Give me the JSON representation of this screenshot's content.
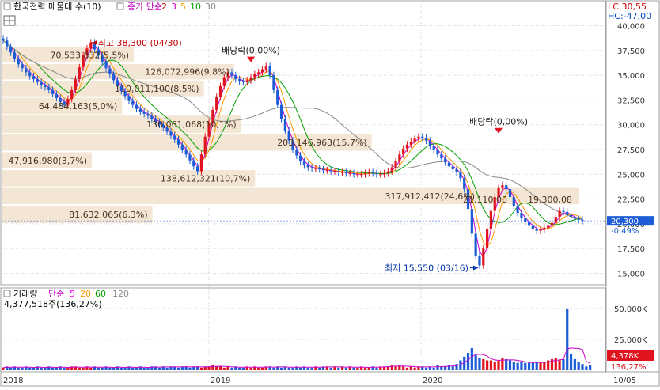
{
  "header": {
    "title": "한국전력 매물대 수(10)",
    "ma_label": "종가 단순",
    "ma_periods": [
      "2",
      "3",
      "5",
      "10",
      "30"
    ],
    "ma_colors": [
      "#c00000",
      "#ff00ff",
      "#ff9900",
      "#00a000",
      "#888888"
    ],
    "lc_text": "LC:30,55",
    "hc_text": "HC:-47,00"
  },
  "volume_header": {
    "label": "거래량",
    "ma_label": "단순",
    "ma_periods": [
      "5",
      "20",
      "60",
      "120"
    ],
    "ma_colors": [
      "#ff00ff",
      "#ff9900",
      "#00a000",
      "#888888"
    ],
    "value_text": "4,377,518주(136,27%)"
  },
  "chart_data": [
    {
      "type": "candlestick",
      "title": "한국전력 매물대 수(10)",
      "x_labels": [
        "2018",
        "2019",
        "2020",
        "10/05"
      ],
      "ylim": [
        14000,
        41000
      ],
      "y_ticks": [
        15000,
        17500,
        20000,
        22500,
        25000,
        27500,
        30000,
        32500,
        35000,
        37500,
        40000
      ],
      "y_tick_labels": [
        "15,000",
        "17,500",
        "20,000",
        "22,500",
        "25,000",
        "27,500",
        "30,000",
        "32,500",
        "35,000",
        "37,500",
        "40,000"
      ],
      "current_price": 20300,
      "current_price_text": "20,300",
      "current_change_text": "-0,49%",
      "close_series": [
        38500,
        37900,
        37300,
        36700,
        36100,
        35700,
        35300,
        34900,
        34600,
        34300,
        34000,
        33800,
        33500,
        33100,
        32700,
        32300,
        32000,
        32600,
        33500,
        34600,
        35800,
        37000,
        37700,
        38300,
        37600,
        37000,
        36300,
        35700,
        35100,
        34500,
        33900,
        33400,
        32900,
        32400,
        32000,
        31600,
        31300,
        31100,
        30900,
        30600,
        30300,
        30000,
        29700,
        29300,
        28900,
        28500,
        28000,
        27500,
        27000,
        26400,
        25800,
        25300,
        27000,
        28800,
        30200,
        31500,
        32800,
        33900,
        34800,
        35300,
        35000,
        34600,
        34400,
        34300,
        34500,
        34800,
        35100,
        35300,
        35600,
        35900,
        35000,
        33500,
        32000,
        30600,
        29400,
        28400,
        27500,
        26900,
        26300,
        25900,
        25700,
        25600,
        25600,
        25500,
        25400,
        25400,
        25300,
        25300,
        25200,
        25200,
        25100,
        25100,
        25000,
        25000,
        25000,
        25100,
        25200,
        25100,
        25000,
        25000,
        25100,
        25300,
        25700,
        26300,
        27000,
        27600,
        28000,
        28300,
        28600,
        28800,
        28700,
        28400,
        27900,
        27500,
        27000,
        26600,
        26200,
        25800,
        25500,
        25200,
        24600,
        23500,
        21500,
        19000,
        16800,
        15800,
        17500,
        19500,
        21300,
        22700,
        23600,
        23900,
        23500,
        22700,
        21800,
        21100,
        20600,
        20200,
        19800,
        19500,
        19300,
        19400,
        19600,
        19800,
        20100,
        20700,
        21300,
        21200,
        20900,
        20700,
        20500,
        20400,
        20300
      ],
      "volume_series": [
        2,
        3,
        2,
        3,
        2,
        2,
        3,
        2,
        2,
        3,
        2,
        2,
        3,
        2,
        2,
        3,
        2,
        2,
        3,
        3,
        2,
        2,
        3,
        2,
        3,
        2,
        2,
        3,
        2,
        2,
        3,
        2,
        2,
        3,
        2,
        2,
        3,
        2,
        2,
        3,
        3,
        2,
        3,
        2,
        3,
        3,
        2,
        3,
        3,
        2,
        3,
        3,
        2,
        3,
        3,
        4,
        3,
        3,
        2,
        3,
        2,
        3,
        2,
        2,
        3,
        2,
        3,
        2,
        2,
        3,
        3,
        2,
        3,
        2,
        3,
        2,
        2,
        3,
        2,
        3,
        2,
        2,
        3,
        2,
        3,
        3,
        2,
        3,
        2,
        3,
        2,
        3,
        2,
        2,
        3,
        2,
        2,
        3,
        2,
        3,
        3,
        3,
        4,
        3,
        4,
        3,
        2,
        3,
        2,
        3,
        3,
        2,
        3,
        2,
        4,
        3,
        3,
        4,
        3,
        5,
        8,
        11,
        14,
        18,
        12,
        10,
        9,
        8,
        8,
        7,
        8,
        10,
        9,
        8,
        7,
        6,
        7,
        6,
        6,
        6,
        7,
        6,
        7,
        8,
        9,
        10,
        8,
        9,
        50,
        13,
        9,
        7,
        5,
        3,
        4
      ],
      "volume_ylim": [
        0,
        64000000
      ],
      "volume_ticks": [
        25000000,
        50000000
      ],
      "volume_tick_labels": [
        "25,000K",
        "50,000K"
      ],
      "volume_current_text": "4,378K",
      "volume_current_pct": "136,27%",
      "volume_profile": [
        {
          "price_from": 36200,
          "price_to": 37900,
          "label": "70,533,832(5,5%)",
          "share": 5.5
        },
        {
          "price_from": 34500,
          "price_to": 36200,
          "label": "126,072,996(9,8%)",
          "share": 9.8
        },
        {
          "price_from": 32800,
          "price_to": 34500,
          "label": "110,011,100(8,5%)",
          "share": 8.5
        },
        {
          "price_from": 31000,
          "price_to": 32800,
          "label": "64,484,163(5,0%)",
          "share": 5.0
        },
        {
          "price_from": 29100,
          "price_to": 31000,
          "label": "130,061,068(10,1%)",
          "share": 10.1
        },
        {
          "price_from": 27300,
          "price_to": 29100,
          "label": "203,146,963(15,7%)",
          "share": 15.7
        },
        {
          "price_from": 25500,
          "price_to": 27300,
          "label": "47,916,980(3,7%)",
          "share": 3.7
        },
        {
          "price_from": 23700,
          "price_to": 25500,
          "label": "138,612,321(10,7%)",
          "share": 10.7
        },
        {
          "price_from": 21900,
          "price_to": 23700,
          "label": "317,912,412(24,6%)",
          "share": 24.6
        },
        {
          "price_from": 20000,
          "price_to": 21900,
          "label": "81,632,065(6,3%)",
          "share": 6.3
        }
      ],
      "annotations": [
        {
          "text": "최고 38,300 (04/30)",
          "price": 38300
        },
        {
          "text": "최저 15,550 (03/16)",
          "price": 15550
        },
        {
          "text": "배당락(0,00%)",
          "price": 37200
        },
        {
          "text": "배당락(0,00%)",
          "price": 30000
        }
      ],
      "overlay_labels": [
        "21,110,00",
        "19,300,08"
      ]
    }
  ]
}
